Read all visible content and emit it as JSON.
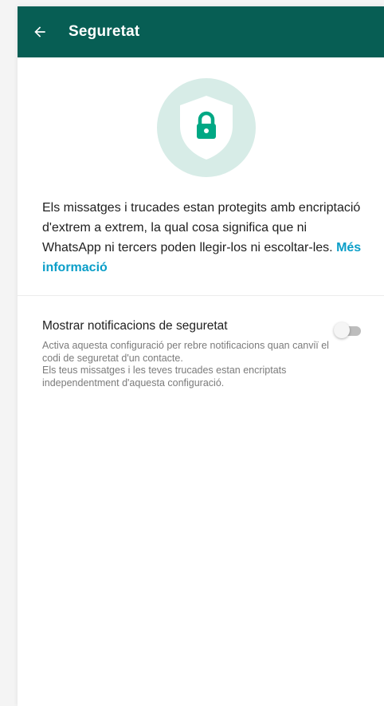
{
  "appbar": {
    "title": "Seguretat",
    "back_icon": "arrow-left-icon",
    "color": "#075e54"
  },
  "hero": {
    "icon": "shield-lock-icon",
    "circle_color": "#d7ece7",
    "lock_color": "#00a884"
  },
  "description": {
    "text": "Els missatges i trucades estan protegits amb encriptació d'extrem a extrem, la qual cosa significa que ni WhatsApp ni tercers poden llegir-los ni escoltar-les.",
    "link": "Més informació",
    "link_color": "#0a9ec8"
  },
  "setting": {
    "title": "Mostrar notificacions de seguretat",
    "subtitle_1": "Activa aquesta configuració per rebre notificacions quan canviï el codi de seguretat d'un contacte.",
    "subtitle_2": "Els teus missatges i les teves trucades estan encriptats independentment d'aquesta configuració.",
    "toggle_on": false
  }
}
